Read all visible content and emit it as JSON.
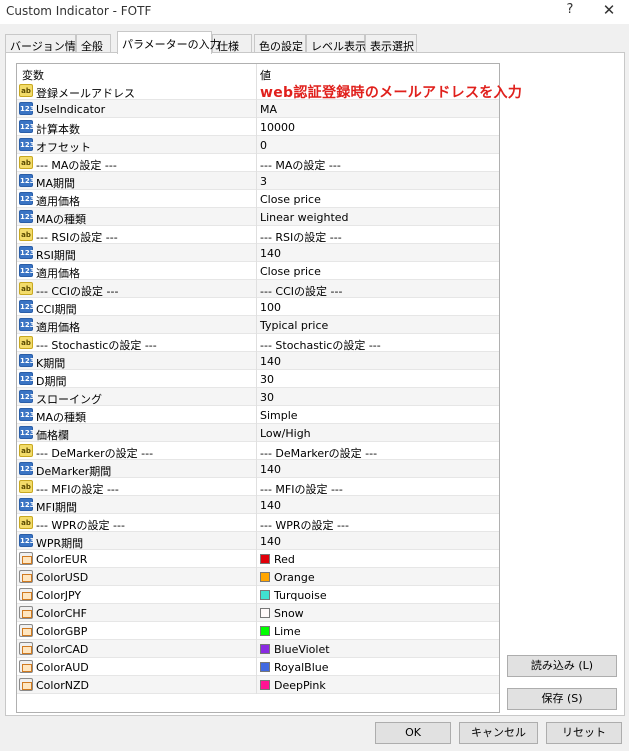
{
  "window": {
    "title": "Custom Indicator - FOTF",
    "help": "?",
    "close": "✕"
  },
  "tabs": [
    {
      "label": "バージョン情報"
    },
    {
      "label": "全般"
    },
    {
      "label": "パラメーターの入力"
    },
    {
      "label": "仕様"
    },
    {
      "label": "色の設定"
    },
    {
      "label": "レベル表示"
    },
    {
      "label": "表示選択"
    }
  ],
  "grid": {
    "col_variable": "変数",
    "col_value": "値",
    "rows": [
      {
        "type": "str",
        "icon_text": "ab",
        "name": "登録メールアドレス",
        "value": "web認証登録時のメールアドレスを入力"
      },
      {
        "type": "num",
        "icon_text": "123",
        "name": "UseIndicator",
        "value": "MA"
      },
      {
        "type": "num",
        "icon_text": "123",
        "name": "計算本数",
        "value": "10000"
      },
      {
        "type": "num",
        "icon_text": "123",
        "name": "オフセット",
        "value": "0"
      },
      {
        "type": "str",
        "icon_text": "ab",
        "name": "--- MAの設定 ---",
        "value": "--- MAの設定 ---"
      },
      {
        "type": "num",
        "icon_text": "123",
        "name": "MA期間",
        "value": "3"
      },
      {
        "type": "num",
        "icon_text": "123",
        "name": "適用価格",
        "value": "Close price"
      },
      {
        "type": "num",
        "icon_text": "123",
        "name": "MAの種類",
        "value": "Linear weighted"
      },
      {
        "type": "str",
        "icon_text": "ab",
        "name": "--- RSIの設定 ---",
        "value": "--- RSIの設定 ---"
      },
      {
        "type": "num",
        "icon_text": "123",
        "name": "RSI期間",
        "value": "140"
      },
      {
        "type": "num",
        "icon_text": "123",
        "name": "適用価格",
        "value": "Close price"
      },
      {
        "type": "str",
        "icon_text": "ab",
        "name": "--- CCIの設定 ---",
        "value": "--- CCIの設定 ---"
      },
      {
        "type": "num",
        "icon_text": "123",
        "name": "CCI期間",
        "value": "100"
      },
      {
        "type": "num",
        "icon_text": "123",
        "name": "適用価格",
        "value": "Typical price"
      },
      {
        "type": "str",
        "icon_text": "ab",
        "name": "--- Stochasticの設定 ---",
        "value": "--- Stochasticの設定 ---"
      },
      {
        "type": "num",
        "icon_text": "123",
        "name": "K期間",
        "value": "140"
      },
      {
        "type": "num",
        "icon_text": "123",
        "name": "D期間",
        "value": "30"
      },
      {
        "type": "num",
        "icon_text": "123",
        "name": "スローイング",
        "value": "30"
      },
      {
        "type": "num",
        "icon_text": "123",
        "name": "MAの種類",
        "value": "Simple"
      },
      {
        "type": "num",
        "icon_text": "123",
        "name": "価格欄",
        "value": "Low/High"
      },
      {
        "type": "str",
        "icon_text": "ab",
        "name": "--- DeMarkerの設定 ---",
        "value": "--- DeMarkerの設定 ---"
      },
      {
        "type": "num",
        "icon_text": "123",
        "name": "DeMarker期間",
        "value": "140"
      },
      {
        "type": "str",
        "icon_text": "ab",
        "name": "--- MFIの設定 ---",
        "value": "--- MFIの設定 ---"
      },
      {
        "type": "num",
        "icon_text": "123",
        "name": "MFI期間",
        "value": "140"
      },
      {
        "type": "str",
        "icon_text": "ab",
        "name": "--- WPRの設定 ---",
        "value": "--- WPRの設定 ---"
      },
      {
        "type": "num",
        "icon_text": "123",
        "name": "WPR期間",
        "value": "140"
      },
      {
        "type": "col",
        "icon_text": "",
        "name": "ColorEUR",
        "value": "Red",
        "color": "#e0000a"
      },
      {
        "type": "col",
        "icon_text": "",
        "name": "ColorUSD",
        "value": "Orange",
        "color": "#ffa500"
      },
      {
        "type": "col",
        "icon_text": "",
        "name": "ColorJPY",
        "value": "Turquoise",
        "color": "#40e0d0"
      },
      {
        "type": "col",
        "icon_text": "",
        "name": "ColorCHF",
        "value": "Snow",
        "color": "#fffafa"
      },
      {
        "type": "col",
        "icon_text": "",
        "name": "ColorGBP",
        "value": "Lime",
        "color": "#00ff00"
      },
      {
        "type": "col",
        "icon_text": "",
        "name": "ColorCAD",
        "value": "BlueViolet",
        "color": "#8a2be2"
      },
      {
        "type": "col",
        "icon_text": "",
        "name": "ColorAUD",
        "value": "RoyalBlue",
        "color": "#4169e1"
      },
      {
        "type": "col",
        "icon_text": "",
        "name": "ColorNZD",
        "value": "DeepPink",
        "color": "#ff1493"
      }
    ]
  },
  "side_buttons": {
    "load": "読み込み (L)",
    "save": "保存 (S)"
  },
  "footer_buttons": {
    "ok": "OK",
    "cancel": "キャンセル",
    "reset": "リセット"
  }
}
